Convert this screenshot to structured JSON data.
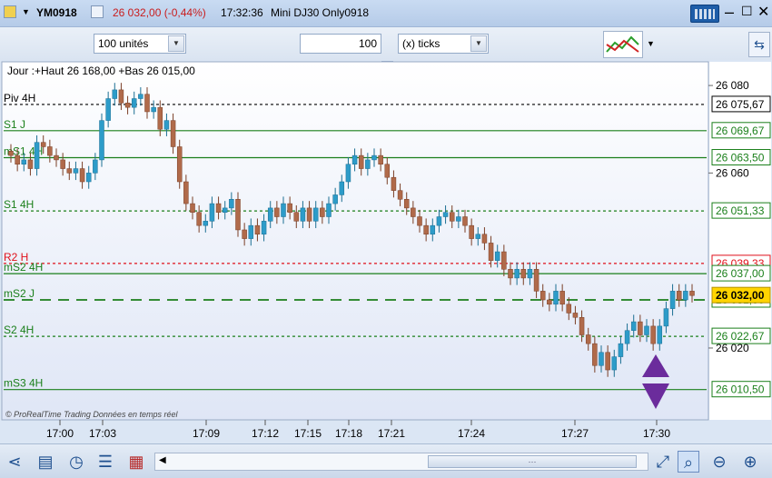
{
  "titlebar": {
    "symbol": "YM0918",
    "change": "26 032,00 (-0,44%)",
    "time": "17:32:36",
    "name": "Mini DJ30 Only0918"
  },
  "toolbar": {
    "units_value": "100 unités",
    "ticks_value": "100",
    "ticks_unit": "(x) ticks"
  },
  "chart_data": {
    "type": "candlestick",
    "header": "Jour :+Haut 26 168,00 +Bas 26 015,00",
    "watermark": "© ProRealTime Trading  Données en temps réel",
    "ylim": [
      26004,
      26085
    ],
    "y_ticks": [
      "26 080",
      "26 060",
      "26 020"
    ],
    "x_ticks": [
      "17:00",
      "17:03",
      "17:09",
      "17:12",
      "17:15",
      "17:18",
      "17:21",
      "17:24",
      "17:27",
      "17:30"
    ],
    "levels": [
      {
        "name": "Piv 4H",
        "value": 26075.67,
        "label": "26 075,67",
        "color": "#000000",
        "style": "dotted"
      },
      {
        "name": "S1 J",
        "value": 26069.67,
        "label": "26 069,67",
        "color": "#1a7f1a",
        "style": "solid"
      },
      {
        "name": "mS1 4H",
        "value": 26063.5,
        "label": "26 063,50",
        "color": "#1a7f1a",
        "style": "solid"
      },
      {
        "name": "S1 4H",
        "value": 26051.33,
        "label": "26 051,33",
        "color": "#1a7f1a",
        "style": "dotted"
      },
      {
        "name": "R2 H",
        "value": 26039.33,
        "label": "26 039,33",
        "color": "#e0101a",
        "style": "dotted"
      },
      {
        "name": "mS2 4H",
        "value": 26037.0,
        "label": "26 037,00",
        "color": "#1a7f1a",
        "style": "solid"
      },
      {
        "name": "mS2 J",
        "value": 26031.0,
        "label": "26 031,00",
        "color": "#1a7f1a",
        "style": "dashed"
      },
      {
        "name": "S2 4H",
        "value": 26022.67,
        "label": "26 022,67",
        "color": "#1a7f1a",
        "style": "dotted"
      },
      {
        "name": "mS3 4H",
        "value": 26010.5,
        "label": "26 010,50",
        "color": "#1a7f1a",
        "style": "solid"
      }
    ],
    "last_price": {
      "value": 26032.0,
      "label": "26 032,00"
    },
    "closes": [
      26064,
      26062,
      26063,
      26061,
      26067,
      26066,
      26064,
      26063,
      26061,
      26060,
      26061,
      26058,
      26060,
      26063,
      26072,
      26077,
      26079,
      26076,
      26075,
      26077,
      26078,
      26074,
      26075,
      26070,
      26072,
      26066,
      26058,
      26053,
      26051,
      26048,
      26049,
      26053,
      26051,
      26052,
      26054,
      26047,
      26045,
      26048,
      26046,
      26049,
      26052,
      26050,
      26053,
      26051,
      26049,
      26052,
      26049,
      26052,
      26050,
      26053,
      26055,
      26058,
      26062,
      26064,
      26061,
      26063,
      26064,
      26062,
      26059,
      26056,
      26054,
      26052,
      26050,
      26048,
      26046,
      26048,
      26050,
      26051,
      26049,
      26050,
      26048,
      26045,
      26046,
      26044,
      26040,
      26042,
      26038,
      26036,
      26038,
      26036,
      26038,
      26033,
      26031,
      26030,
      26033,
      26030,
      26028,
      26027,
      26023,
      26021,
      26016,
      26019,
      26015,
      26018,
      26021,
      26024,
      26026,
      26023,
      26025,
      26021,
      26025,
      26029,
      26033,
      26031,
      26033,
      26032
    ]
  },
  "statusbar": {
    "scroll_label": "⋯"
  }
}
